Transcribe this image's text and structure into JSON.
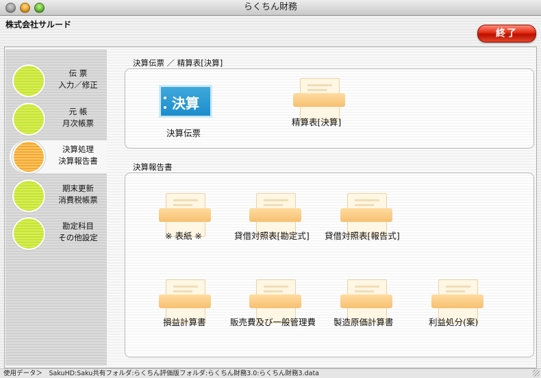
{
  "window": {
    "title": "らくちん財務"
  },
  "header": {
    "company": "株式会社サルード",
    "exit_label": "終了"
  },
  "sidebar": {
    "items": [
      {
        "line1": "伝 票",
        "line2": "入力／修正",
        "active": false
      },
      {
        "line1": "元 帳",
        "line2": "月次帳票",
        "active": false
      },
      {
        "line1": "決算処理",
        "line2": "決算報告書",
        "active": true
      },
      {
        "line1": "期末更新",
        "line2": "消費税帳票",
        "active": false
      },
      {
        "line1": "勘定科目",
        "line2": "その他設定",
        "active": false
      }
    ]
  },
  "sections": {
    "top": {
      "title": "決算伝票 ／ 精算表[決算]",
      "items": [
        {
          "icon_text": "決算",
          "label": "決算伝票",
          "icon": "kessan-blue-icon"
        },
        {
          "label": "精算表[決算]",
          "icon": "document-icon"
        }
      ]
    },
    "bottom": {
      "title": "決算報告書",
      "items": [
        {
          "label": "※ 表紙 ※"
        },
        {
          "label": "貸借対照表[勘定式]"
        },
        {
          "label": "貸借対照表[報告式]"
        },
        {
          "label": "損益計算書"
        },
        {
          "label": "販売費及び一般管理費"
        },
        {
          "label": "製造原価計算書"
        },
        {
          "label": "利益処分(案)"
        }
      ]
    }
  },
  "status": {
    "text": "使用データ＞　SakuHD:Saku共有フォルダ:らくちん評価版フォルダ:らくちん財務3.0:らくちん財務3.data"
  },
  "colors": {
    "accent_green": "#c6e33a",
    "accent_orange": "#f2a63a",
    "exit_red": "#e42a12",
    "kessan_blue": "#1c8ccc"
  }
}
